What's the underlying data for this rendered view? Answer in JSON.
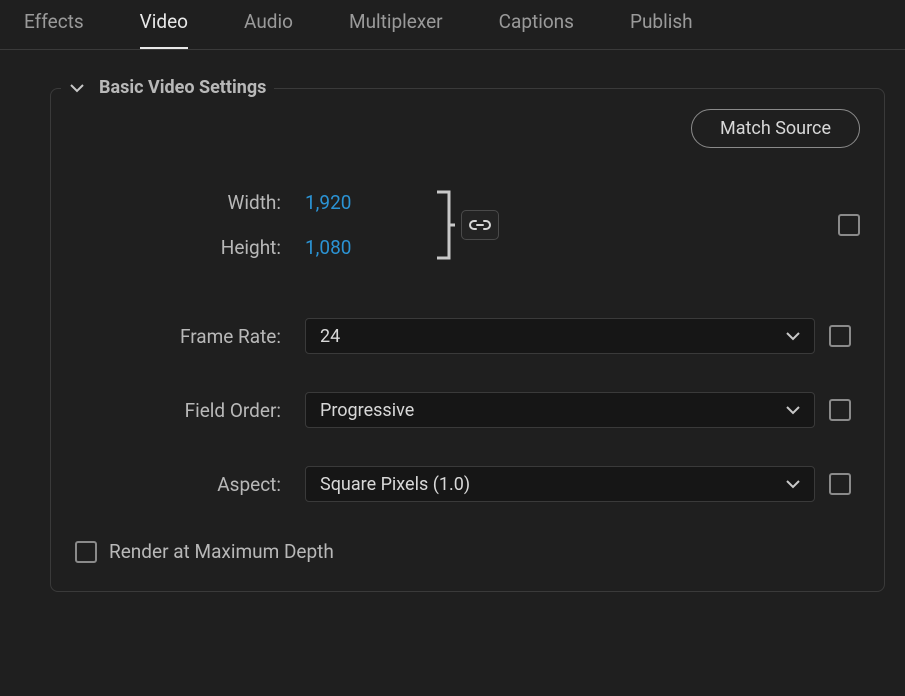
{
  "tabs": {
    "effects": "Effects",
    "video": "Video",
    "audio": "Audio",
    "multiplexer": "Multiplexer",
    "captions": "Captions",
    "publish": "Publish"
  },
  "section": {
    "title": "Basic Video Settings",
    "match_source": "Match Source",
    "width_label": "Width:",
    "width_value": "1,920",
    "height_label": "Height:",
    "height_value": "1,080",
    "framerate_label": "Frame Rate:",
    "framerate_value": "24",
    "fieldorder_label": "Field Order:",
    "fieldorder_value": "Progressive",
    "aspect_label": "Aspect:",
    "aspect_value": "Square Pixels (1.0)",
    "render_label": "Render at Maximum Depth"
  }
}
